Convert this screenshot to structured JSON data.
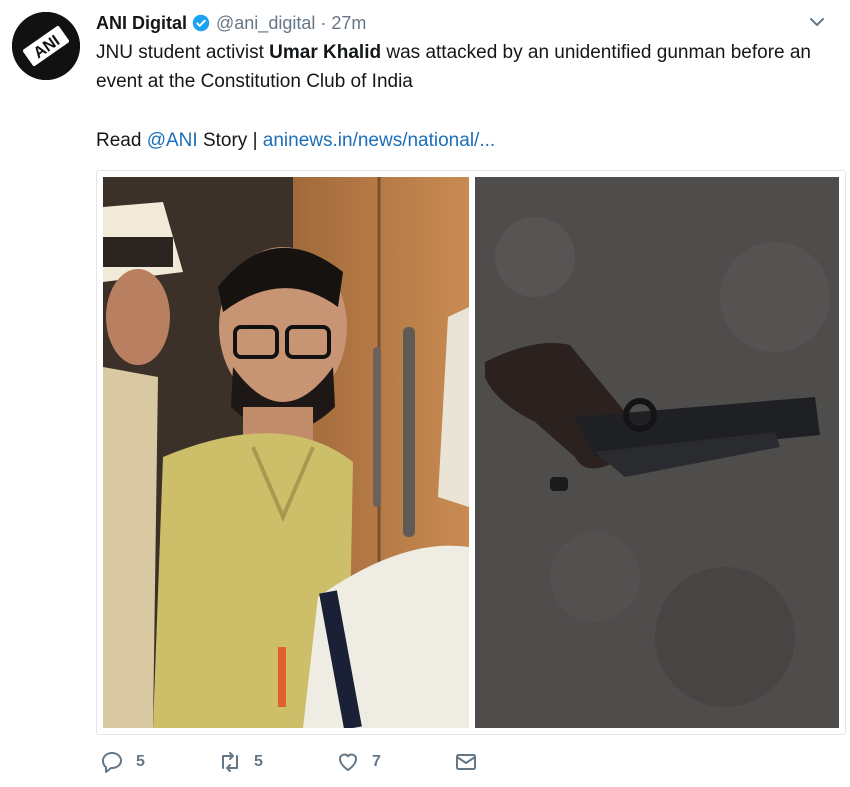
{
  "tweet": {
    "display_name": "ANI Digital",
    "handle": "@ani_digital",
    "separator": "·",
    "time": "27m",
    "avatar_text": "ANI",
    "text_part1": "JNU student activist ",
    "text_bold": "Umar Khalid",
    "text_part2": " was attacked by an unidentified gunman before an event at the Constitution Club of India",
    "read_prefix": "Read ",
    "read_mention": "@ANI",
    "read_middle": " Story | ",
    "read_link": "aninews.in/news/national/..."
  },
  "actions": {
    "reply_count": "5",
    "retweet_count": "5",
    "like_count": "7"
  },
  "media": {
    "left_photo": "photo-activist-with-police",
    "right_photo": "photo-pistol-on-road"
  },
  "colors": {
    "link": "#1b6fb8",
    "verified": "#1da1f2",
    "muted": "#657786"
  }
}
